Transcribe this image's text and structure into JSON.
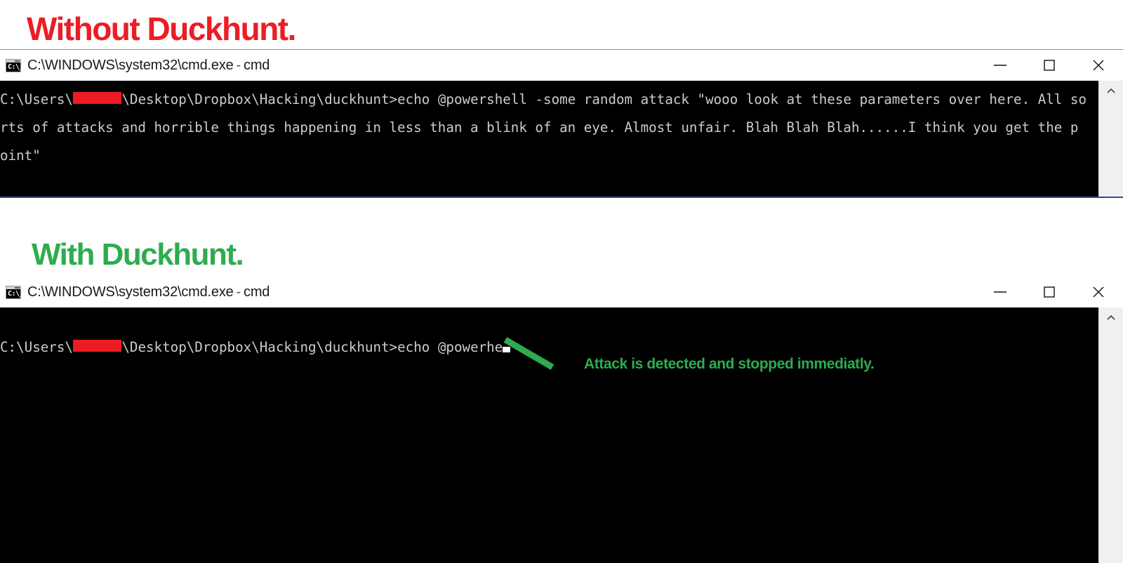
{
  "sections": [
    {
      "heading": "Without Duckhunt.",
      "heading_color": "#ed1c24"
    },
    {
      "heading": "With Duckhunt.",
      "heading_color": "#2eac4f"
    }
  ],
  "window_without": {
    "icon": "cmd-console-icon",
    "icon_glyph": "C:\\_",
    "title_path": "C:\\WINDOWS\\system32\\cmd.exe",
    "title_sep": "-",
    "title_suffix": "cmd",
    "controls": {
      "minimize": "minimize-icon",
      "maximize": "maximize-icon",
      "close": "close-icon"
    },
    "console": {
      "prompt_prefix": "C:\\Users\\",
      "redacted_user": "██████",
      "prompt_suffix": "\\Desktop\\Dropbox\\Hacking\\duckhunt>",
      "command": "echo @powershell -some random attack \"wooo look at these parameters over here. All sorts of attacks and horrible things happening in less than a blink of an eye. Almost unfair. Blah Blah Blah......I think you get the point\"",
      "line2_visible": "rts of attacks and horrible things happening in less than a blink of an eye. Almost unfair. Blah Blah Blah......I think you get the p",
      "line3_visible": "oint\"",
      "line1_visible": "C:\\Users\\██████\\Desktop\\Dropbox\\Hacking\\duckhunt>echo @powershell -some random attack \"wooo look at these parameters over here. All so",
      "scroll_up_arrow": "chevron-up-icon"
    }
  },
  "window_with": {
    "icon": "cmd-console-icon",
    "icon_glyph": "C:\\_",
    "title_path": "C:\\WINDOWS\\system32\\cmd.exe",
    "title_sep": "-",
    "title_suffix": "cmd",
    "controls": {
      "minimize": "minimize-icon",
      "maximize": "maximize-icon",
      "close": "close-icon"
    },
    "console": {
      "prompt_prefix": "C:\\Users\\",
      "redacted_user": "██████",
      "prompt_suffix": "\\Desktop\\Dropbox\\Hacking\\duckhunt>",
      "typed_text": "echo @powerhe",
      "line1_visible": "C:\\Users\\██████\\Desktop\\Dropbox\\Hacking\\duckhunt>echo @powerhe",
      "cursor": "caret-block",
      "scroll_up_arrow": "chevron-up-icon"
    }
  },
  "annotation": {
    "text": "Attack is detected and stopped immediatly.",
    "color": "#2eac4f",
    "pointer": "arrow-line"
  },
  "colors": {
    "red": "#ed1c24",
    "green": "#2eac4f",
    "console_bg": "#000000",
    "console_fg": "#cccccc",
    "window_border_top": "#5b9bd5",
    "window_border_bottom": "#2a4f91",
    "scrollbar_bg": "#f0f0f0"
  }
}
